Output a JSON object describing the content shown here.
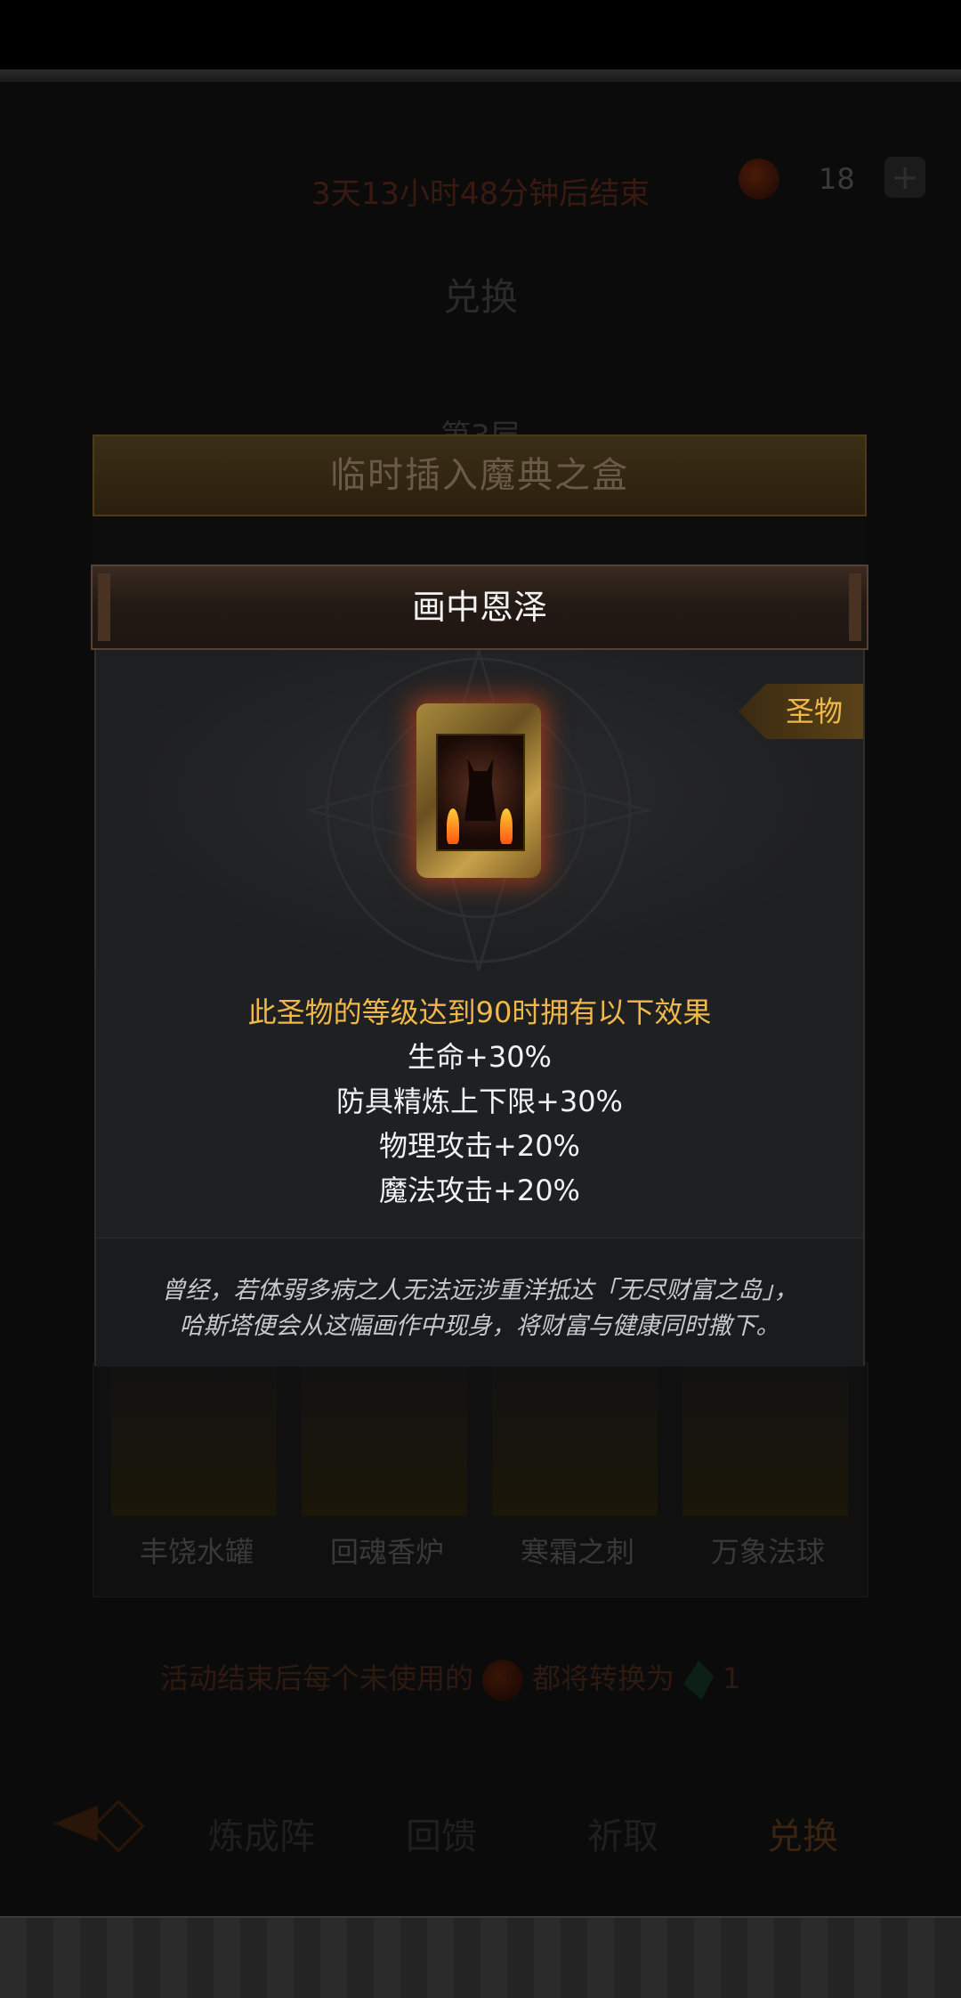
{
  "background": {
    "timer": "3天13小时48分钟后结束",
    "currency_count": "18",
    "exchange_title": "兑换",
    "floor_label": "第3层",
    "items": [
      {
        "label": "丰饶水罐"
      },
      {
        "label": "回魂香炉"
      },
      {
        "label": "寒霜之刺"
      },
      {
        "label": "万象法球"
      }
    ],
    "notice": {
      "before": "活动结束后每个未使用的",
      "middle": "都将转换为",
      "amount": "1"
    },
    "nav_tabs": [
      "炼成阵",
      "回馈",
      "祈取",
      "兑换"
    ]
  },
  "gold_bar_title": "临时插入魔典之盒",
  "modal": {
    "title": "画中恩泽",
    "badge": "圣物",
    "effects_header": "此圣物的等级达到90时拥有以下效果",
    "effects": [
      "生命+30%",
      "防具精炼上下限+30%",
      "物理攻击+20%",
      "魔法攻击+20%"
    ],
    "lore": [
      "曾经，若体弱多病之人无法远涉重洋抵达「无尽财富之岛」，",
      "哈斯塔便会从这幅画作中现身，将财富与健康同时撒下。"
    ]
  }
}
